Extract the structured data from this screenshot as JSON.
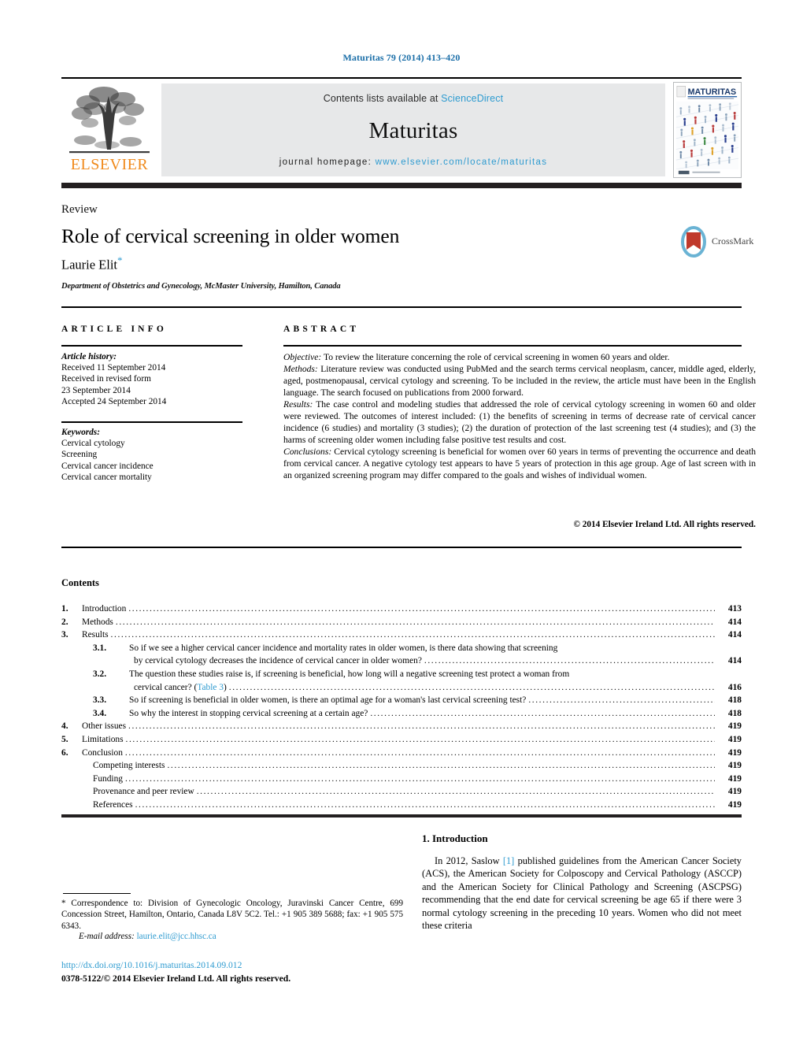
{
  "running_head": "Maturitas 79 (2014) 413–420",
  "masthead": {
    "publisher_logo_text": "ELSEVIER",
    "contents_available_prefix": "Contents lists available at ",
    "contents_available_link": "ScienceDirect",
    "journal_name": "Maturitas",
    "homepage_prefix": "journal homepage: ",
    "homepage_url": "www.elsevier.com/locate/maturitas",
    "cover_title": "MATURITAS",
    "cover_subtitle": "The European Menopause and Andropause Society Journal",
    "cover_footer": "Elsevier"
  },
  "title_block": {
    "section_kind": "Review",
    "title": "Role of cervical screening in older women",
    "author": "Laurie Elit",
    "author_marker": "*",
    "affiliation": "Department of Obstetrics and Gynecology, McMaster University, Hamilton, Canada",
    "crossmark_label": "CrossMark"
  },
  "article_info": {
    "header": "ARTICLE INFO",
    "history_label": "Article history:",
    "history_lines": [
      "Received 11 September 2014",
      "Received in revised form",
      "23 September 2014",
      "Accepted 24 September 2014"
    ],
    "keywords_label": "Keywords:",
    "keywords": [
      "Cervical cytology",
      "Screening",
      "Cervical cancer incidence",
      "Cervical cancer mortality"
    ]
  },
  "abstract": {
    "header": "ABSTRACT",
    "paragraphs": [
      {
        "label": "Objective:",
        "text": " To review the literature concerning the role of cervical screening in women 60 years and older."
      },
      {
        "label": "Methods:",
        "text": " Literature review was conducted using PubMed and the search terms cervical neoplasm, cancer, middle aged, elderly, aged, postmenopausal, cervical cytology and screening. To be included in the review, the article must have been in the English language. The search focused on publications from 2000 forward."
      },
      {
        "label": "Results:",
        "text": " The case control and modeling studies that addressed the role of cervical cytology screening in women 60 and older were reviewed. The outcomes of interest included: (1) the benefits of screening in terms of decrease rate of cervical cancer incidence (6 studies) and mortality (3 studies); (2) the duration of protection of the last screening test (4 studies); and (3) the harms of screening older women including false positive test results and cost."
      },
      {
        "label": "Conclusions:",
        "text": " Cervical cytology screening is beneficial for women over 60 years in terms of preventing the occurrence and death from cervical cancer. A negative cytology test appears to have 5 years of protection in this age group. Age of last screen with in an organized screening program may differ compared to the goals and wishes of individual women."
      }
    ],
    "copyright": "© 2014 Elsevier Ireland Ltd. All rights reserved."
  },
  "contents": {
    "title": "Contents",
    "entries": [
      {
        "num": "1.",
        "label": "Introduction",
        "page": "413",
        "level": 1
      },
      {
        "num": "2.",
        "label": "Methods",
        "page": "414",
        "level": 1
      },
      {
        "num": "3.",
        "label": "Results",
        "page": "414",
        "level": 1
      },
      {
        "num": "3.1.",
        "label": "So if we see a higher cervical cancer incidence and mortality rates in older women, is there data showing that screening",
        "label2": "by cervical cytology decreases the incidence of cervical cancer in older women?",
        "page": "414",
        "level": 2
      },
      {
        "num": "3.2.",
        "label": "The question these studies raise is, if screening is beneficial, how long will a negative screening test protect a woman from",
        "label2": "cervical cancer? (",
        "link": "Table 3",
        "label3": ")",
        "page": "416",
        "level": 2
      },
      {
        "num": "3.3.",
        "label": "So if screening is beneficial in older women, is there an optimal age for a woman's last cervical screening test?",
        "page": "418",
        "level": 2
      },
      {
        "num": "3.4.",
        "label": "So why the interest in stopping cervical screening at a certain age?",
        "page": "418",
        "level": 2
      },
      {
        "num": "4.",
        "label": "Other issues",
        "page": "419",
        "level": 1
      },
      {
        "num": "5.",
        "label": "Limitations",
        "page": "419",
        "level": 1
      },
      {
        "num": "6.",
        "label": "Conclusion",
        "page": "419",
        "level": 1
      },
      {
        "num": "",
        "label": "Competing interests",
        "page": "419",
        "level": 3
      },
      {
        "num": "",
        "label": "Funding",
        "page": "419",
        "level": 3
      },
      {
        "num": "",
        "label": "Provenance and peer review",
        "page": "419",
        "level": 3
      },
      {
        "num": "",
        "label": "References",
        "page": "419",
        "level": 3
      }
    ]
  },
  "introduction": {
    "heading": "1. Introduction",
    "text_before_ref": "In 2012, Saslow ",
    "ref": "[1]",
    "text_after_ref": " published guidelines from the American Cancer Society (ACS), the American Society for Colposcopy and Cervical Pathology (ASCCP) and the American Society for Clinical Pathology and Screening (ASCPSG) recommending that the end date for cervical screening be age 65 if there were 3 normal cytology screening in the preceding 10 years. Women who did not meet these criteria"
  },
  "footnotes": {
    "correspondence": "* Correspondence to: Division of Gynecologic Oncology, Juravinski Cancer Centre, 699 Concession Street, Hamilton, Ontario, Canada L8V 5C2. Tel.: +1 905 389 5688; fax: +1 905 575 6343.",
    "email_label": "E-mail address:",
    "email": "laurie.elit@jcc.hhsc.ca",
    "doi": "http://dx.doi.org/10.1016/j.maturitas.2014.09.012",
    "issn_line": "0378-5122/© 2014 Elsevier Ireland Ltd. All rights reserved."
  },
  "colors": {
    "link_blue": "#2e9bd0",
    "running_head_blue": "#1a6ea8",
    "elsevier_orange": "#f08a1c",
    "band_gray": "#e7e8e9",
    "rule_black": "#231f20"
  }
}
